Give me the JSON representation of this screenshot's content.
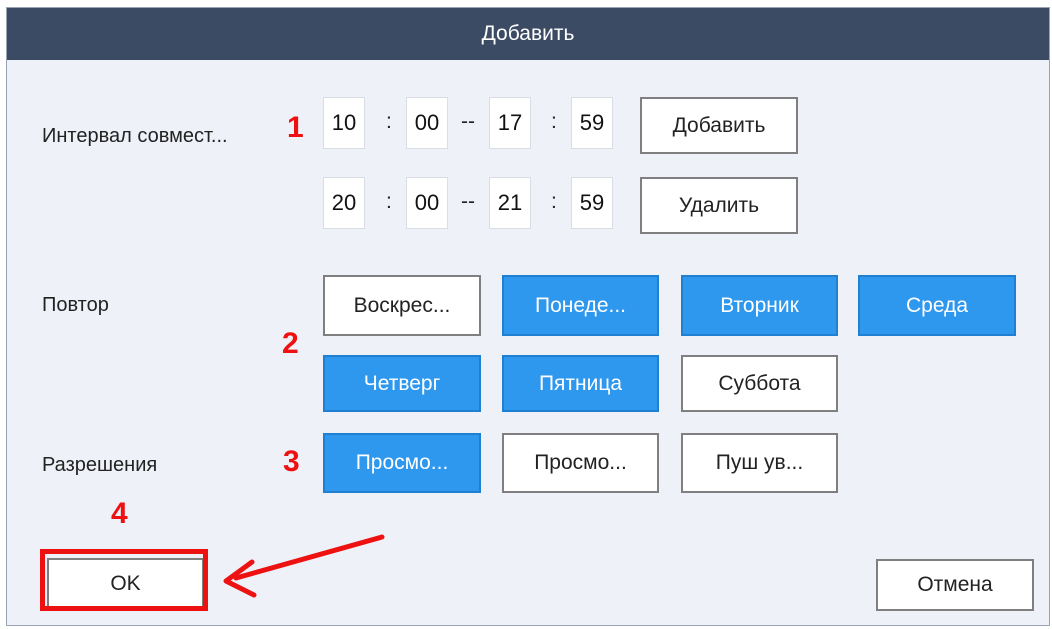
{
  "dialog": {
    "title": "Добавить",
    "interval": {
      "label": "Интервал совмест...",
      "rows": [
        {
          "start_h": "10",
          "start_m": "00",
          "end_h": "17",
          "end_m": "59"
        },
        {
          "start_h": "20",
          "start_m": "00",
          "end_h": "21",
          "end_m": "59"
        }
      ],
      "colon": ":",
      "dash": "--",
      "add_label": "Добавить",
      "delete_label": "Удалить"
    },
    "repeat": {
      "label": "Повтор",
      "days": [
        {
          "label": "Воскрес...",
          "selected": false
        },
        {
          "label": "Понеде...",
          "selected": true
        },
        {
          "label": "Вторник",
          "selected": true
        },
        {
          "label": "Среда",
          "selected": true
        },
        {
          "label": "Четверг",
          "selected": true
        },
        {
          "label": "Пятница",
          "selected": true
        },
        {
          "label": "Суббота",
          "selected": false
        }
      ]
    },
    "permissions": {
      "label": "Разрешения",
      "items": [
        {
          "label": "Просмо...",
          "selected": true
        },
        {
          "label": "Просмо...",
          "selected": false
        },
        {
          "label": "Пуш ув...",
          "selected": false
        }
      ]
    },
    "ok_label": "OK",
    "cancel_label": "Отмена"
  },
  "annotations": {
    "step1": "1",
    "step2": "2",
    "step3": "3",
    "step4": "4",
    "color": "#ee1111"
  },
  "colors": {
    "titlebar": "#3c4b64",
    "selected_button": "#2e97ee",
    "dialog_bg": "#eef1f8"
  }
}
